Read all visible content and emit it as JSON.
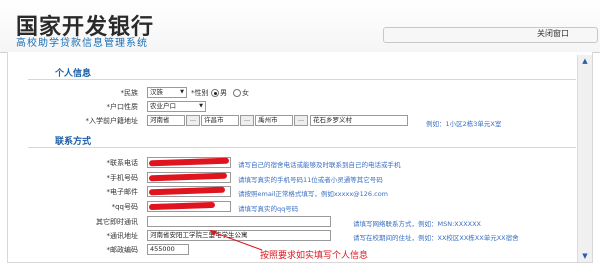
{
  "header": {
    "bank_name": "国家开发银行",
    "system_name": "高校助学贷款信息管理系统",
    "close_label": "关闭窗口"
  },
  "personal": {
    "section_title": "个人信息",
    "ethnicity_label": "*民族",
    "ethnicity_value": "汉族",
    "gender_label": "*性别",
    "gender_male": "男",
    "gender_female": "女",
    "gender_selected": "男",
    "hukou_label": "*户口性质",
    "hukou_value": "农业户口",
    "address_label": "*入学前户籍地址",
    "province": "河南省",
    "city": "许昌市",
    "county": "禹州市",
    "village": "花石乡罗义村",
    "address_example": "例如：1小区2栋3单元X室"
  },
  "contact": {
    "section_title": "联系方式",
    "phone_label": "*联系电话",
    "phone_hint": "请写自己的宿舍电话或能够及时联系到自己的电话或手机",
    "mobile_label": "*手机号码",
    "mobile_hint": "请填写真实的手机号码11位或者小灵通等其它号码",
    "email_label": "*电子邮件",
    "email_hint": "请按照email正常格式填写，例如xxxxx@126.com",
    "qq_label": "*qq号码",
    "qq_hint": "请填写真实的qq号码",
    "other_im_label": "其它即时通讯",
    "other_im_value": "",
    "other_im_hint": "请填写网络联系方式，例如：MSN:XXXXXX",
    "mail_addr_label": "*通讯地址",
    "mail_addr_value": "河南省安阳工学院三里屯学生公寓",
    "mail_addr_hint": "请写在校期间的住址，例如：XX校区XX栋XX单元XX宿舍",
    "postcode_label": "*邮政编码",
    "postcode_value": "455000"
  },
  "annotation": "按照要求如实填写个人信息",
  "colors": {
    "accent": "#1a5ea8",
    "hint": "#3a6fc2",
    "annotation": "#e0141e"
  }
}
